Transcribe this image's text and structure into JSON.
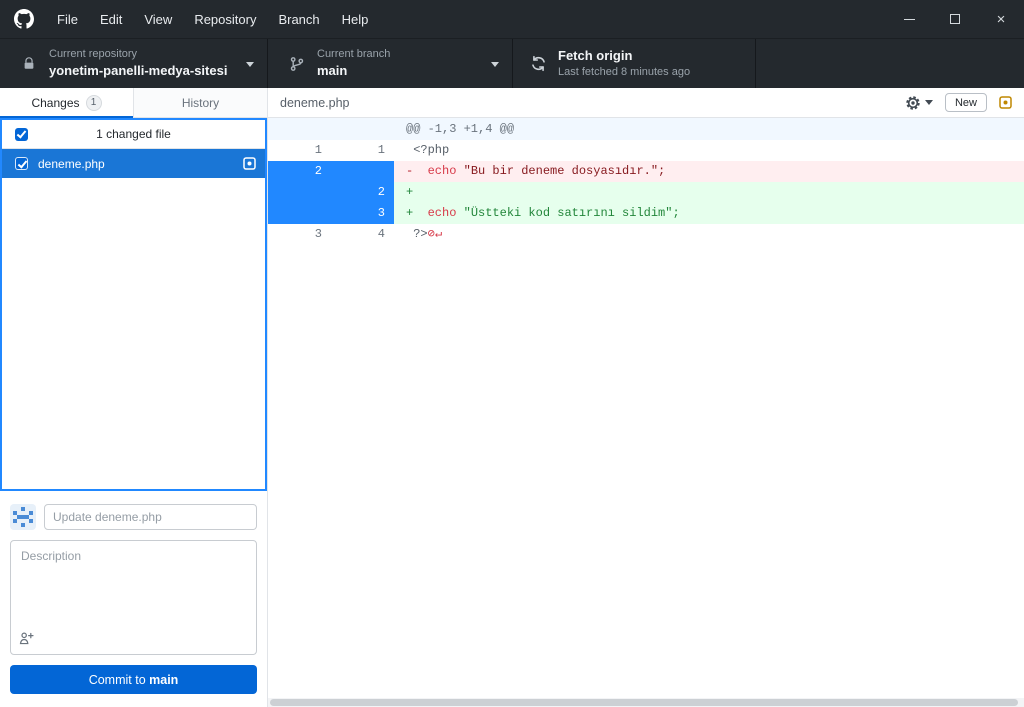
{
  "window": {
    "menu": [
      "File",
      "Edit",
      "View",
      "Repository",
      "Branch",
      "Help"
    ]
  },
  "toolbar": {
    "repository": {
      "label": "Current repository",
      "value": "yonetim-panelli-medya-sitesi"
    },
    "branch": {
      "label": "Current branch",
      "value": "main"
    },
    "fetch": {
      "title": "Fetch origin",
      "subtitle": "Last fetched 8 minutes ago"
    }
  },
  "sidebar": {
    "tabs": {
      "changes": "Changes",
      "changes_badge": "1",
      "history": "History"
    },
    "files_summary": "1 changed file",
    "files": [
      {
        "name": "deneme.php",
        "status": "modified"
      }
    ],
    "commit": {
      "summary_placeholder": "Update deneme.php",
      "description_placeholder": "Description",
      "button_text": "Commit to ",
      "button_branch": "main"
    }
  },
  "diff_header": {
    "filename": "deneme.php",
    "new_button": "New"
  },
  "diff": {
    "hunk": "@@ -1,3 +1,4 @@",
    "lines": [
      {
        "old": "1",
        "new": "1",
        "type": "context",
        "selected": false,
        "tokens": [
          {
            "text": " <?php",
            "color": "#586069"
          }
        ]
      },
      {
        "old": "2",
        "new": "",
        "type": "deleted",
        "selected": true,
        "tokens": [
          {
            "text": "-  ",
            "color": "#b31d28"
          },
          {
            "text": "echo ",
            "color": "#d73a49"
          },
          {
            "text": "\"Bu bir deneme dosyasıdır.\";",
            "color": "#86181d"
          }
        ]
      },
      {
        "old": "",
        "new": "2",
        "type": "added",
        "selected": true,
        "tokens": [
          {
            "text": "+",
            "color": "#22863a"
          }
        ]
      },
      {
        "old": "",
        "new": "3",
        "type": "added",
        "selected": true,
        "tokens": [
          {
            "text": "+  ",
            "color": "#22863a"
          },
          {
            "text": "echo ",
            "color": "#d73a49"
          },
          {
            "text": "\"Üstteki kod satırını sildim\";",
            "color": "#22863a"
          }
        ]
      },
      {
        "old": "3",
        "new": "4",
        "type": "context",
        "selected": false,
        "tokens": [
          {
            "text": " ?>",
            "color": "#586069"
          },
          {
            "text": "⊘↵",
            "color": "#d73a49"
          }
        ]
      }
    ]
  },
  "colors": {
    "titlebar_bg": "#24292e",
    "accent_blue": "#0366d6",
    "selection_blue": "#2188ff",
    "file_row_blue": "#1a76d6",
    "added_bg": "#e6ffed",
    "deleted_bg": "#ffeef0",
    "hunk_bg": "#f1f8ff",
    "modified_yellow": "#bf8700"
  }
}
